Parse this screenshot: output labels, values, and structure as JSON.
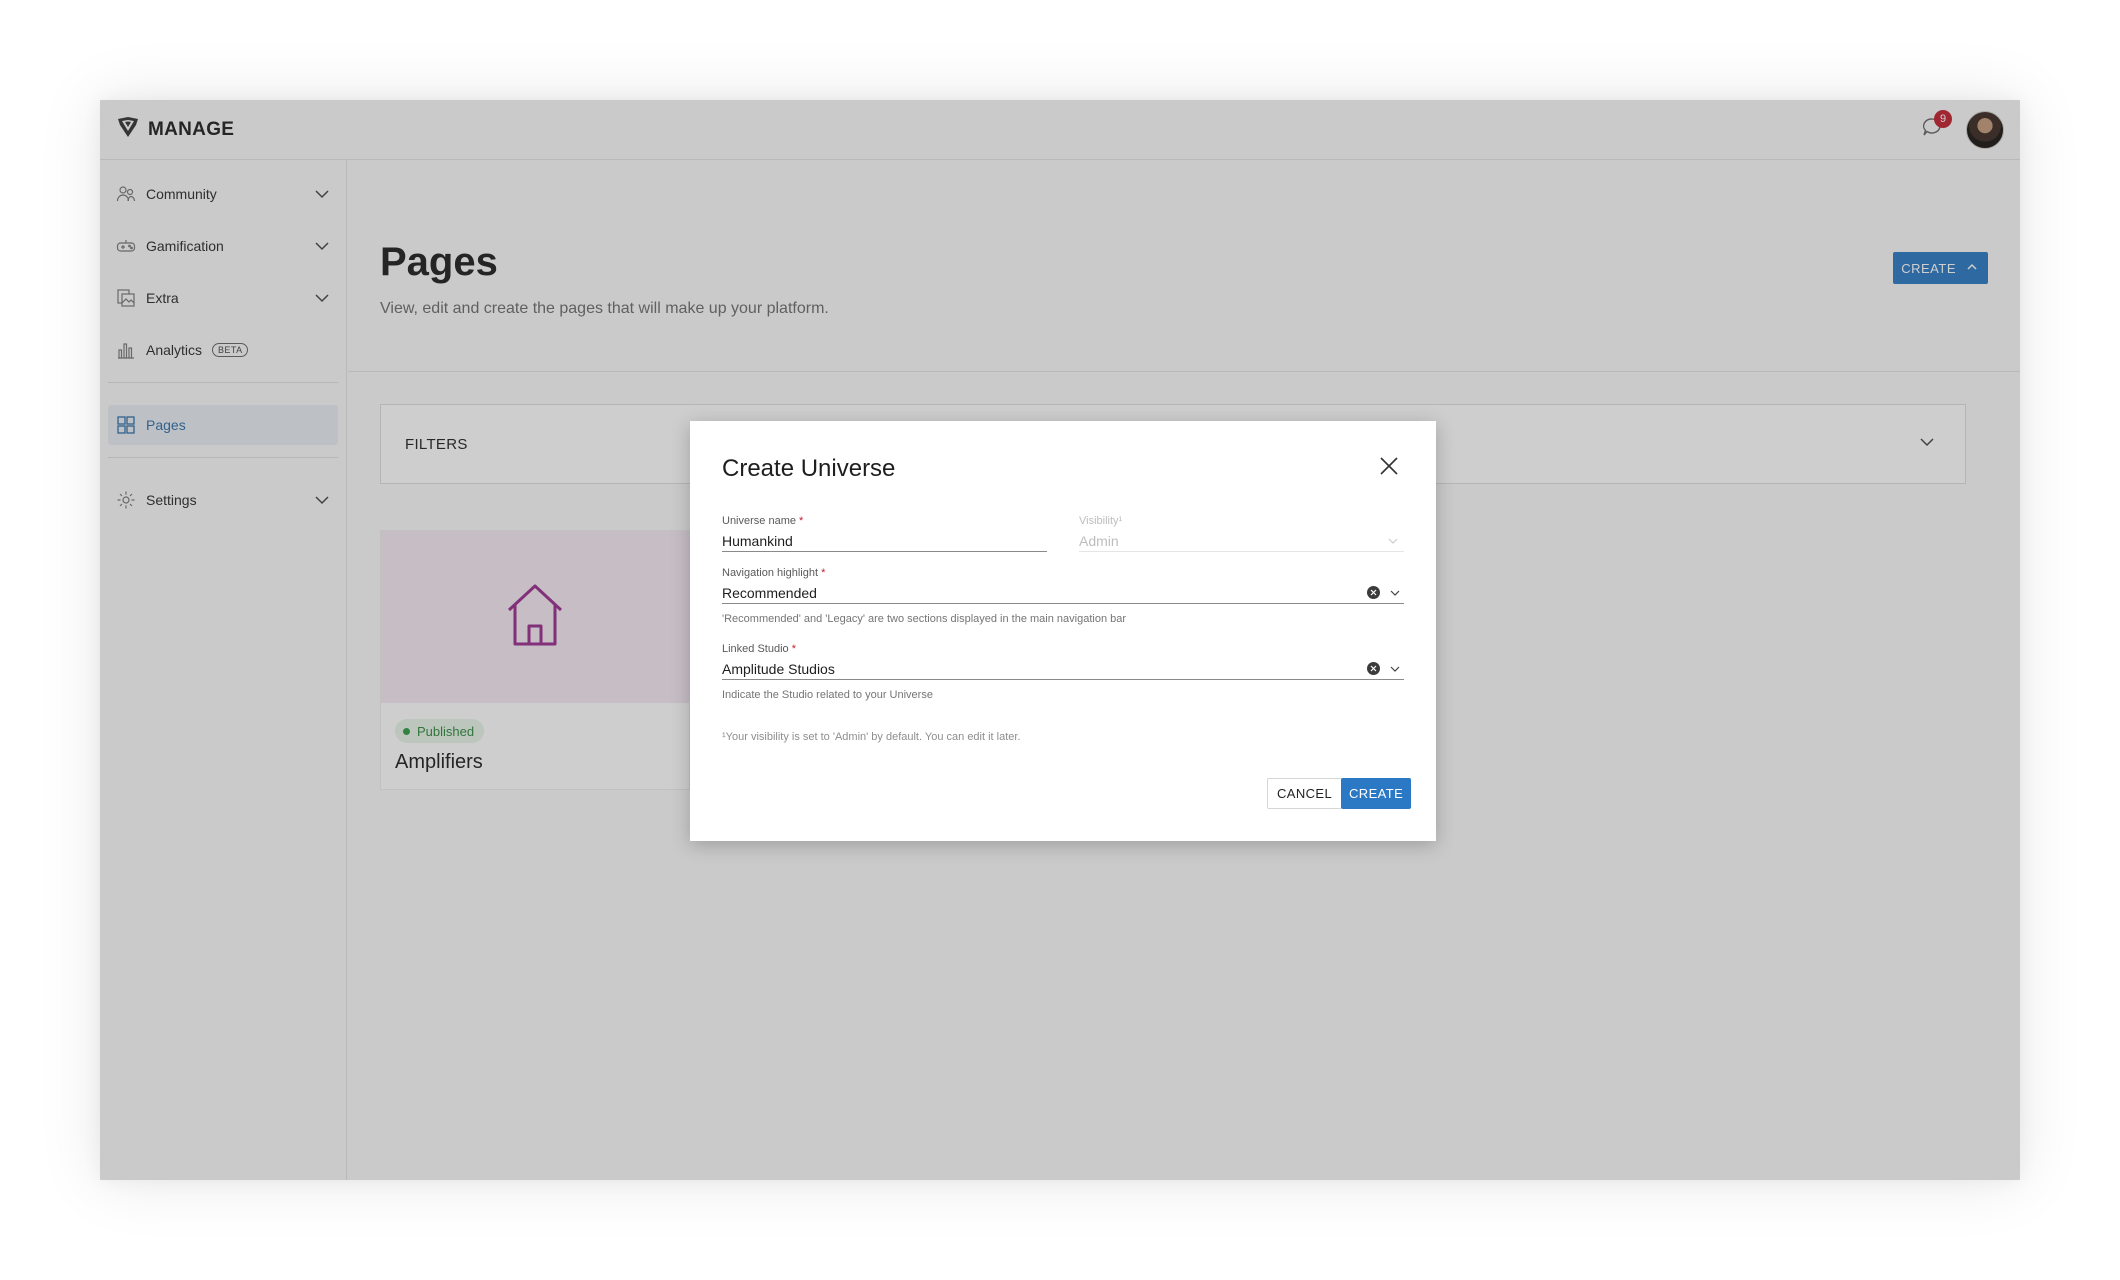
{
  "app": {
    "brand": "MANAGE",
    "notifications_count": "9"
  },
  "sidebar": {
    "items": [
      {
        "label": "Community",
        "icon": "people-icon"
      },
      {
        "label": "Gamification",
        "icon": "gamepad-icon"
      },
      {
        "label": "Extra",
        "icon": "image-stack-icon"
      },
      {
        "label": "Analytics",
        "icon": "bar-chart-icon",
        "badge": "BETA"
      },
      {
        "label": "Pages",
        "icon": "grid-icon",
        "active": true
      },
      {
        "label": "Settings",
        "icon": "gear-icon"
      }
    ]
  },
  "main": {
    "title": "Pages",
    "subtitle": "View, edit and create the pages that will make up your platform.",
    "create_label": "CREATE",
    "filters_label": "FILTERS",
    "card": {
      "status": "Published",
      "title": "Amplifiers",
      "icon": "home-icon"
    }
  },
  "modal": {
    "title": "Create Universe",
    "universe_name": {
      "label": "Universe name",
      "required": "*",
      "value": "Humankind"
    },
    "visibility": {
      "label": "Visibility¹",
      "value": "Admin"
    },
    "navigation_highlight": {
      "label": "Navigation highlight",
      "required": "*",
      "value": "Recommended",
      "help": "'Recommended' and 'Legacy' are two sections displayed in the main navigation bar"
    },
    "linked_studio": {
      "label": "Linked Studio",
      "required": "*",
      "value": "Amplitude Studios",
      "help": "Indicate the Studio related to your Universe"
    },
    "note": "¹Your visibility is set to 'Admin' by default. You can edit it later.",
    "cancel_label": "CANCEL",
    "create_label": "CREATE"
  },
  "colors": {
    "accent": "#2b78c5",
    "badge": "#c21f2e",
    "published": "#2e8a3d",
    "card_thumb": "#f4e8f3",
    "home_icon": "#9a2d8e"
  }
}
